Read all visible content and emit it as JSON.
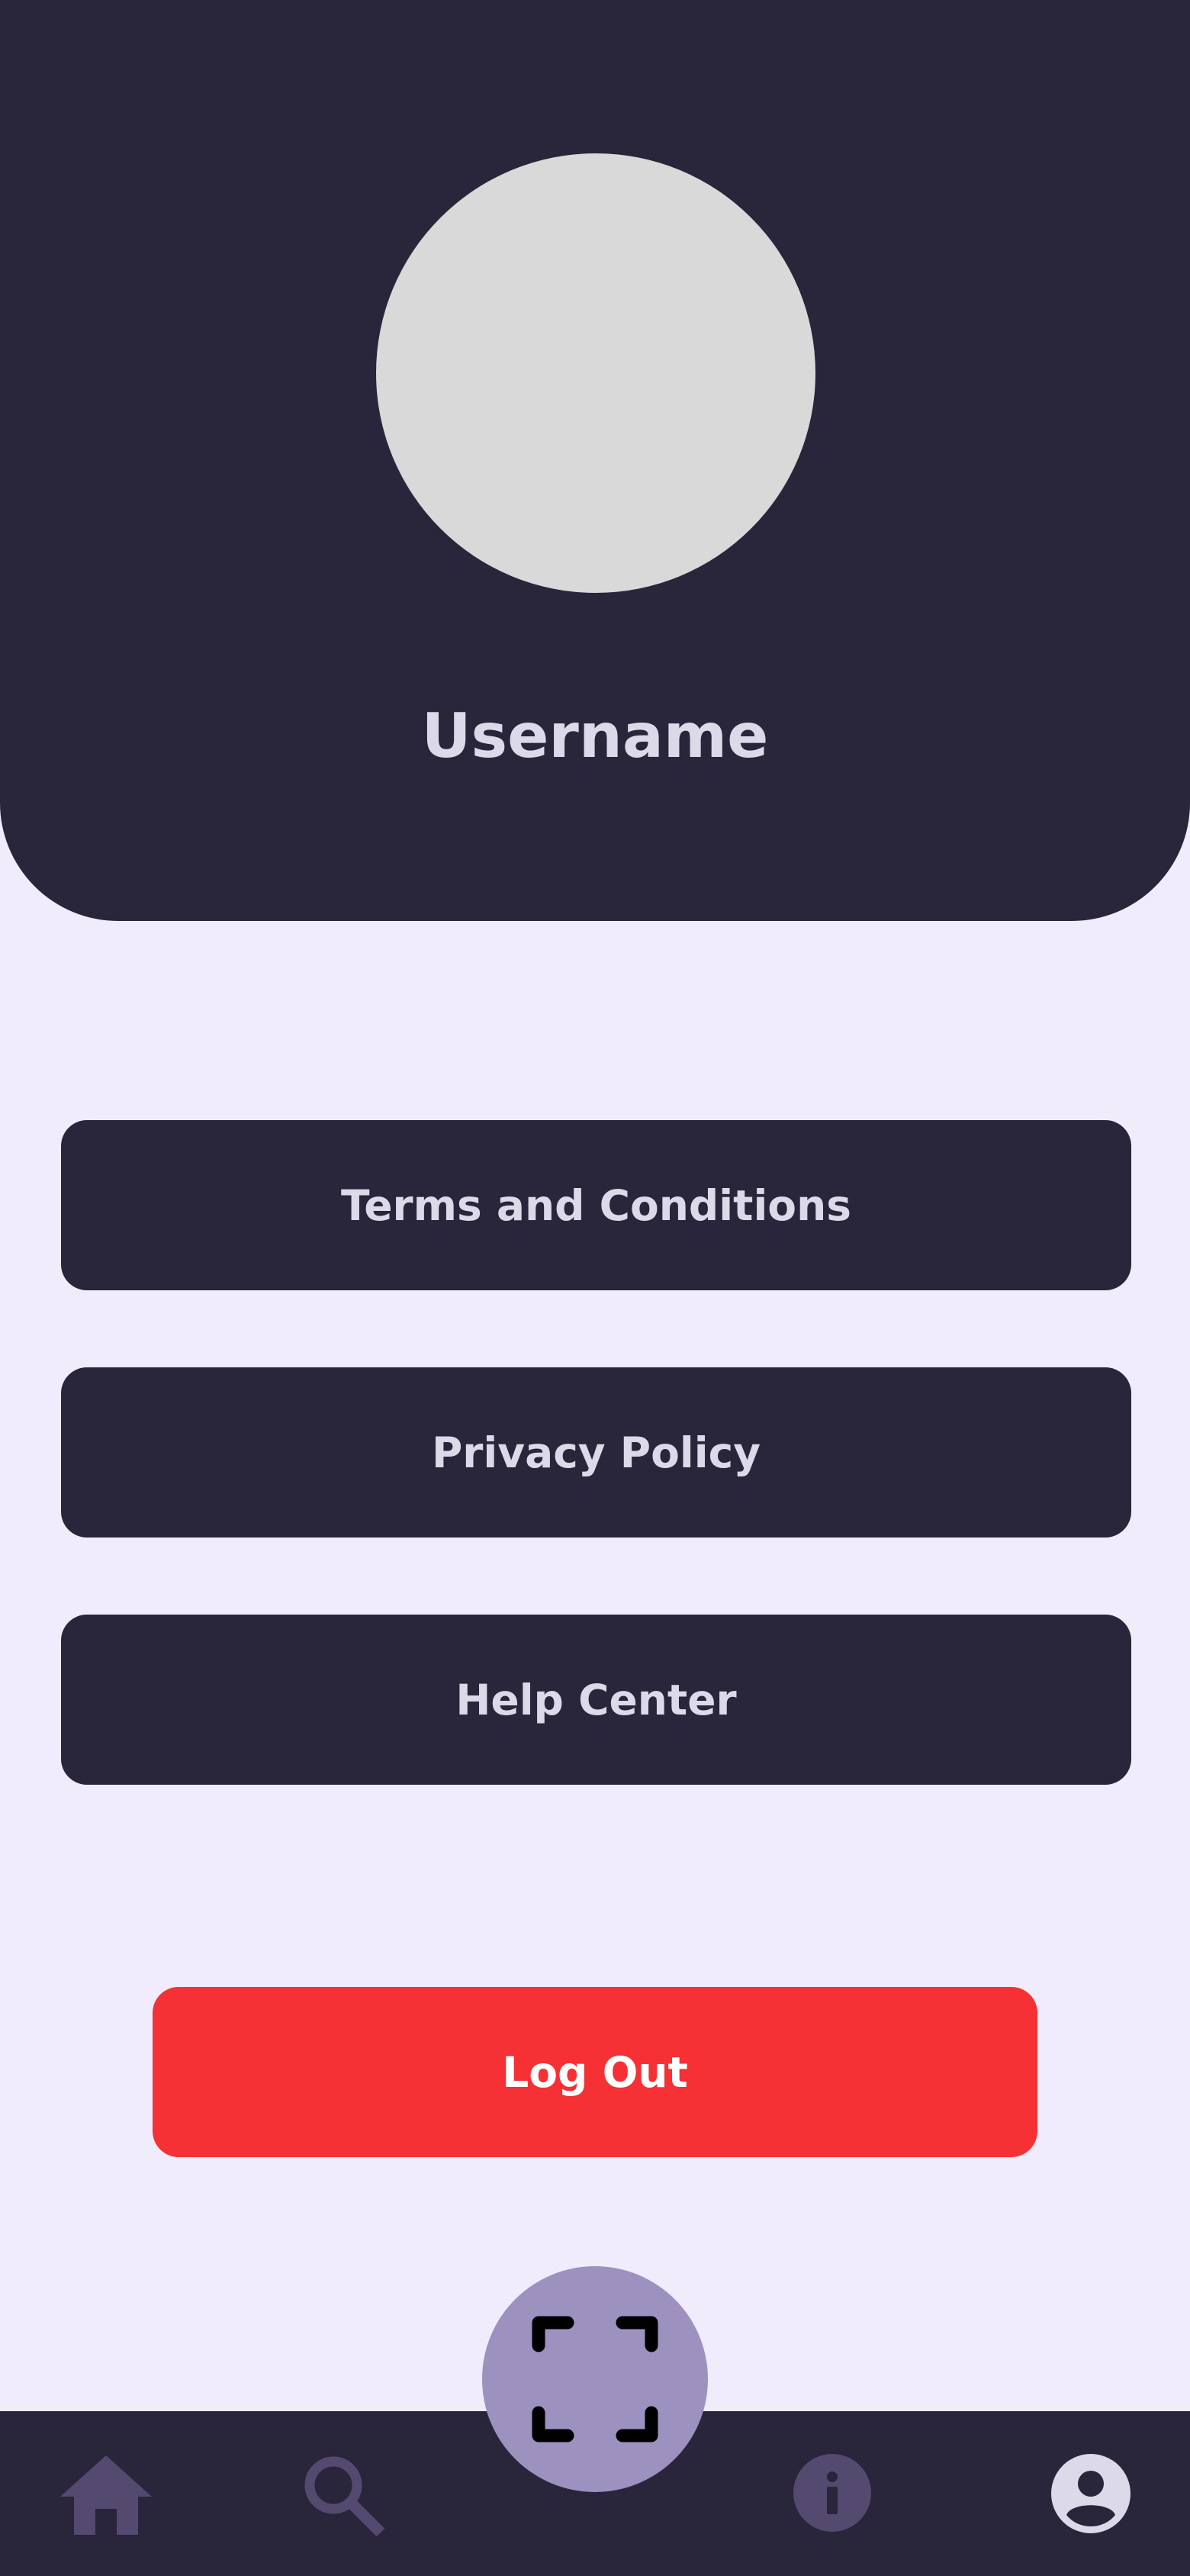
{
  "profile": {
    "username": "Username"
  },
  "menu": {
    "items": [
      {
        "label": "Terms and Conditions"
      },
      {
        "label": "Privacy Policy"
      },
      {
        "label": "Help Center"
      }
    ]
  },
  "logout": {
    "label": "Log Out"
  },
  "bottom_nav": {
    "items": [
      {
        "icon": "home-icon"
      },
      {
        "icon": "search-icon"
      },
      {
        "icon": "scan-icon"
      },
      {
        "icon": "info-icon"
      },
      {
        "icon": "profile-icon"
      }
    ]
  },
  "colors": {
    "header_bg": "#29253A",
    "page_bg": "#F0ECFC",
    "accent_text": "#DCD9E8",
    "logout_red": "#F53135",
    "scan_button": "#9D91C0",
    "inactive_nav_icon": "#544A6F"
  }
}
